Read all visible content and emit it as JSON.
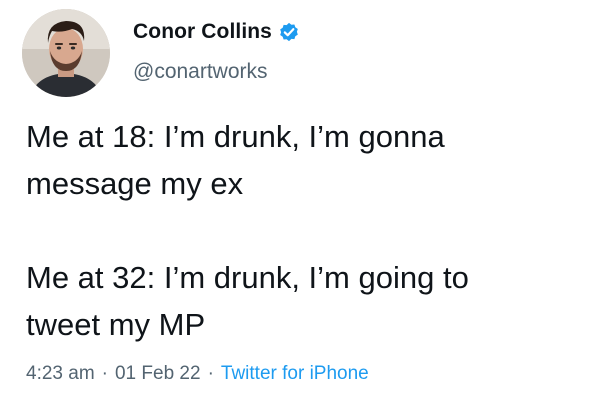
{
  "author": {
    "display_name": "Conor Collins",
    "handle": "@conartworks",
    "verified": true,
    "verified_color": "#1d9bf0",
    "avatar_icon": "profile-photo"
  },
  "tweet": {
    "paragraph_1": "Me at 18: I’m drunk, I’m gonna\nmessage my ex",
    "paragraph_2": "Me at 32: I’m drunk, I’m going to\ntweet my MP"
  },
  "meta": {
    "time": "4:23 am",
    "separator": "·",
    "date": "01 Feb 22",
    "source": "Twitter for iPhone",
    "source_color": "#1d9bf0"
  }
}
